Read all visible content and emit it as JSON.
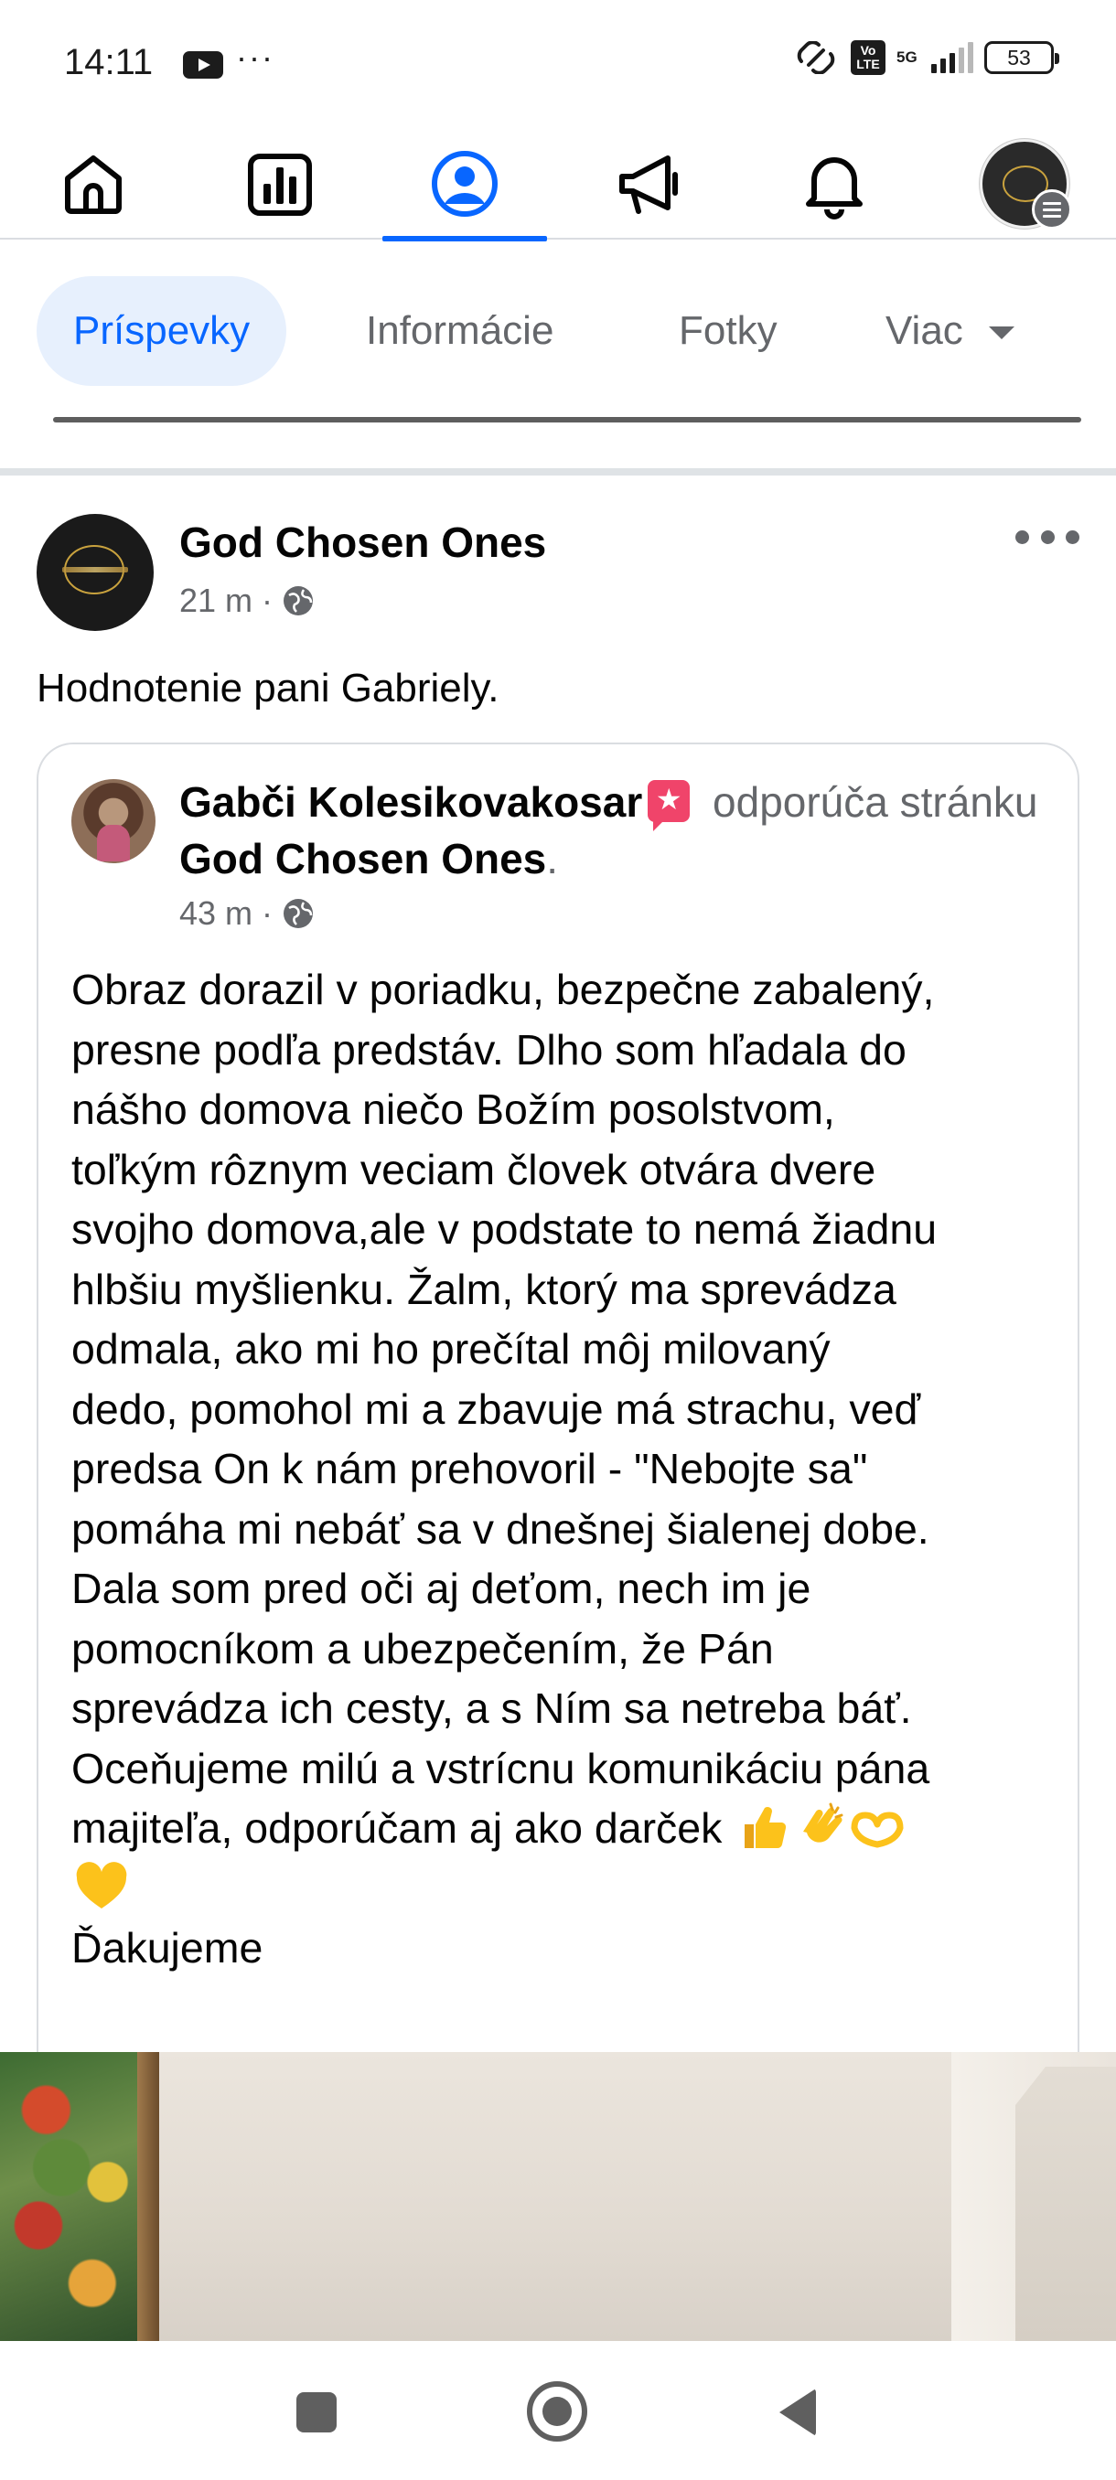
{
  "status_bar": {
    "time": "14:11",
    "more": "···",
    "network": "5G",
    "volte": "Vo LTE",
    "battery": "53"
  },
  "top_nav": {
    "items": [
      {
        "name": "home-icon",
        "active": false
      },
      {
        "name": "dashboard-icon",
        "active": false
      },
      {
        "name": "profile-icon",
        "active": true
      },
      {
        "name": "megaphone-icon",
        "active": false
      },
      {
        "name": "bell-icon",
        "active": false
      },
      {
        "name": "page-avatar-menu",
        "active": false
      }
    ],
    "accent_color": "#0866ff"
  },
  "tabs": {
    "posts": "Príspevky",
    "about": "Informácie",
    "photos": "Fotky",
    "more": "Viac"
  },
  "post": {
    "author": "God Chosen Ones",
    "time": "21 m",
    "dot": "·",
    "caption": "Hodnotenie pani Gabriely.",
    "shared": {
      "reviewer": "Gabči Kolesikovakosar",
      "recommends": "odporúča",
      "page_prefix": "stránku",
      "page_name": "God Chosen Ones",
      "period": ".",
      "time": "43 m",
      "dot": "·",
      "body": "Obraz dorazil v poriadku, bezpečne zabalený,\npresne podľa predstáv. Dlho som hľadala do\nnášho domova niečo Božím posolstvom,\ntoľkým rôznym veciam človek otvára dvere\nsvojho domova,ale v podstate to nemá žiadnu\nhlbšiu myšlienku. Žalm, ktorý ma sprevádza\nodmala, ako mi ho prečítal môj milovaný\ndedo, pomohol mi a zbavuje má strachu, veď\npredsa On  k nám prehovoril - \"Nebojte sa\"\npomáha mi nebáť sa v dnešnej šialenej dobe.\nDala som pred oči aj deťom, nech im je\npomocníkom a ubezpečením, že Pán\nsprevádza ich cesty, a s Ním sa netreba báť.\nOceňujeme milú a vstrícnu komunikáciu pána\nmajiteľa, odporúčam aj ako darček",
      "emojis": [
        "thumbs-up",
        "clapping-hands",
        "heart-hands",
        "yellow-heart"
      ],
      "closing": "Ďakujeme"
    }
  }
}
